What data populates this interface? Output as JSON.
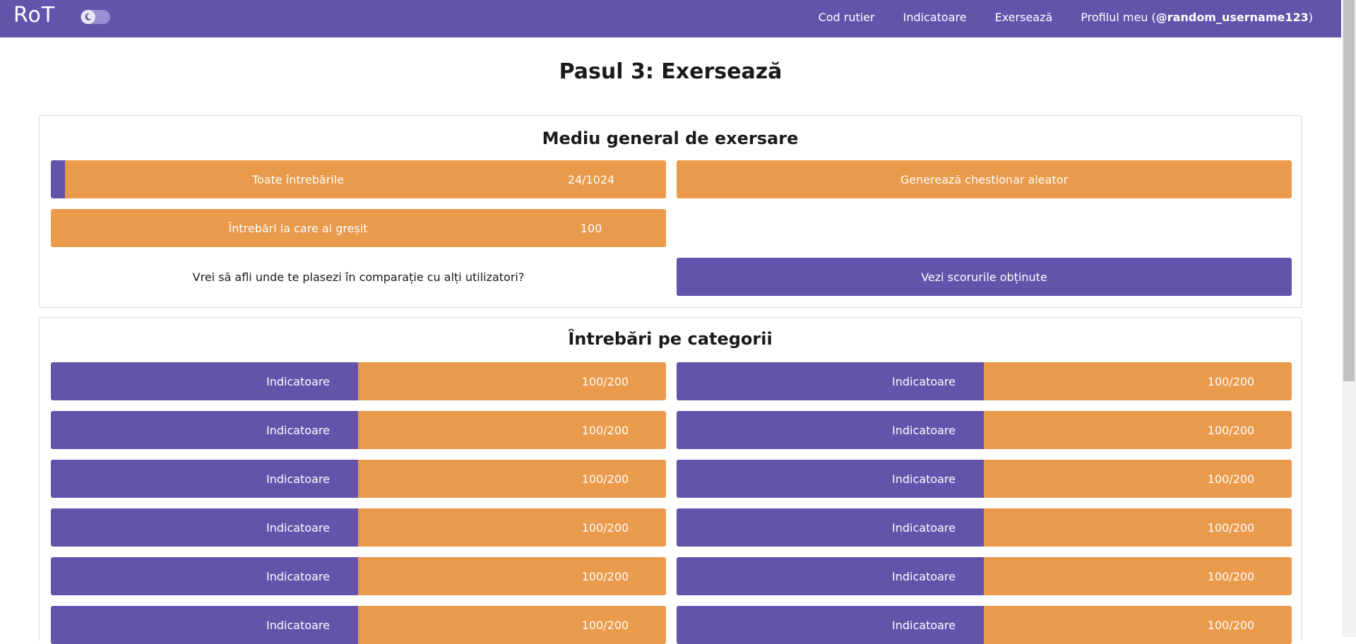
{
  "nav": {
    "brand": "RoT",
    "links": [
      "Cod rutier",
      "Indicatoare",
      "Exersează"
    ],
    "profile_prefix": "Profilul meu (",
    "profile_user": "@random_username123",
    "profile_suffix": ")"
  },
  "page": {
    "title": "Pasul 3: Exersează"
  },
  "general": {
    "title": "Mediu general de exersare",
    "all_questions": {
      "label": "Toate întrebările",
      "count": "24/1024",
      "progress": 0.023
    },
    "random_quiz": {
      "label": "Generează chestionar aleator"
    },
    "wrong_questions": {
      "label": "Întrebări la care ai greșit",
      "count": "100"
    },
    "compare_text": "Vrei să afli unde te plasezi în comparație cu alți utilizatori?",
    "scores_button": "Vezi scorurile obținute"
  },
  "categories": {
    "title": "Întrebări pe categorii",
    "items": [
      {
        "label": "Indicatoare",
        "count": "100/200"
      },
      {
        "label": "Indicatoare",
        "count": "100/200"
      },
      {
        "label": "Indicatoare",
        "count": "100/200"
      },
      {
        "label": "Indicatoare",
        "count": "100/200"
      },
      {
        "label": "Indicatoare",
        "count": "100/200"
      },
      {
        "label": "Indicatoare",
        "count": "100/200"
      },
      {
        "label": "Indicatoare",
        "count": "100/200"
      },
      {
        "label": "Indicatoare",
        "count": "100/200"
      },
      {
        "label": "Indicatoare",
        "count": "100/200"
      },
      {
        "label": "Indicatoare",
        "count": "100/200"
      },
      {
        "label": "Indicatoare",
        "count": "100/200"
      },
      {
        "label": "Indicatoare",
        "count": "100/200"
      }
    ]
  },
  "colors": {
    "primary": "#6453ab",
    "accent": "#e99a4b"
  }
}
